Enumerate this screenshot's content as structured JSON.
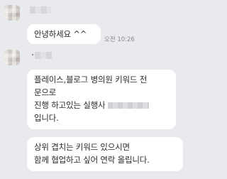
{
  "messages": [
    {
      "lines": [
        "안녕하세요 ^^"
      ],
      "time": "오전 10:26"
    },
    {
      "lines": [
        "플레이스,블로그 병의원 키워드 전",
        "문으로",
        "진행 하고있는 실행사",
        "입니다."
      ]
    },
    {
      "lines": [
        "상위 겹치는 키워드 있으시면",
        "함께 협업하고 싶어 연락 올립니다."
      ]
    }
  ]
}
